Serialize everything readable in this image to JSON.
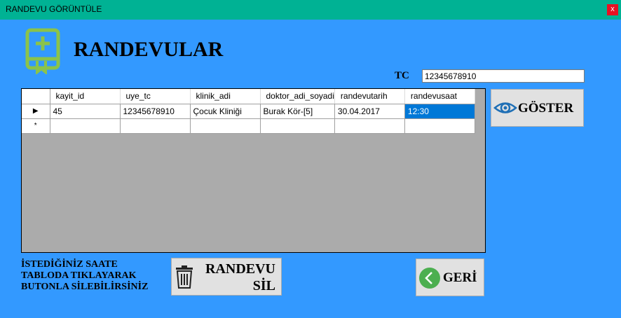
{
  "window": {
    "title": "RANDEVU GÖRÜNTÜLE",
    "close_label": "x"
  },
  "heading": "RANDEVULAR",
  "tc": {
    "label": "TC",
    "value": "12345678910"
  },
  "grid": {
    "columns": [
      "kayit_id",
      "uye_tc",
      "klinik_adi",
      "doktor_adi_soyadi",
      "randevutarih",
      "randevusaat"
    ],
    "rows": [
      {
        "marker": "▶",
        "cells": [
          "45",
          "12345678910",
          "Çocuk Kliniği",
          "Burak Kör-[5]",
          "30.04.2017",
          "12:30"
        ]
      },
      {
        "marker": "*",
        "cells": [
          "",
          "",
          "",
          "",
          "",
          ""
        ]
      }
    ]
  },
  "buttons": {
    "goster": "GÖSTER",
    "sil_line1": "RANDEVU",
    "sil_line2": "SİL",
    "geri": "GERİ"
  },
  "note": {
    "line1": "İSTEDİĞİNİZ SAATE",
    "line2": "TABLODA TIKLAYARAK",
    "line3": "BUTONLA SİLEBİLİRSİNİZ"
  },
  "colors": {
    "background": "#3399ff",
    "titlebar": "#00b294",
    "selection": "#0078d7",
    "icon_green": "#8bc34a"
  },
  "icons": [
    "book-plus-icon",
    "eye-icon",
    "trash-icon",
    "back-arrow-icon"
  ]
}
